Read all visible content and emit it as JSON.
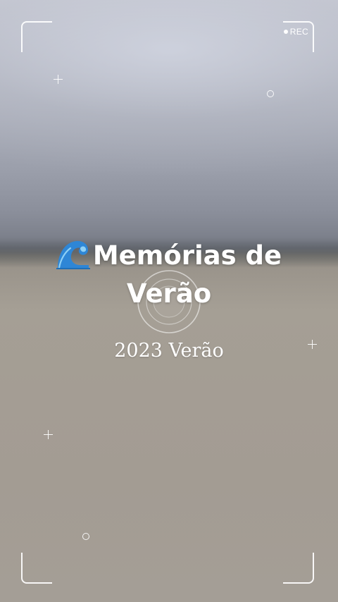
{
  "overlay": {
    "rec_label": "REC"
  },
  "title": {
    "icon": "water-wave-icon",
    "line1": "Memórias de",
    "line2": "Verão"
  },
  "subtitle": "2023 Verão",
  "colors": {
    "overlay": "#ffffff",
    "wave_blue": "#2e86d6",
    "wave_light": "#8fd0f5"
  }
}
